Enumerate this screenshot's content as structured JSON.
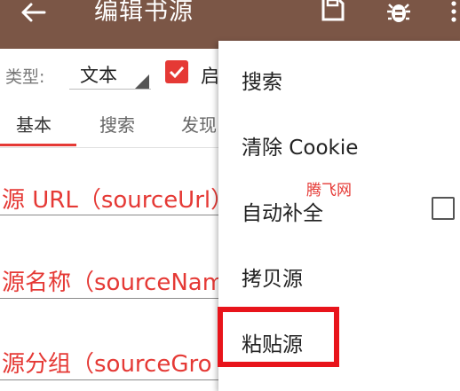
{
  "appbar": {
    "title": "编辑书源",
    "icons": [
      "back-arrow-icon",
      "save-icon",
      "bug-icon",
      "overflow-icon"
    ]
  },
  "type_row": {
    "label": "类型:",
    "value": "文本",
    "enabled_checked": true,
    "enabled_label": "启"
  },
  "tabs": {
    "items": [
      "基本",
      "搜索",
      "发现"
    ],
    "active": "基本"
  },
  "fields": [
    "源 URL（sourceUrl）",
    "源名称（sourceNam",
    "源分组（sourceGro"
  ],
  "menu": {
    "items": [
      "搜索",
      "清除 Cookie",
      "自动补全",
      "拷贝源",
      "粘贴源"
    ],
    "auto_complete_checked": false,
    "highlighted": "粘贴源"
  },
  "watermark": "腾飞网",
  "colors": {
    "appbar": "#7b5646",
    "accent": "#e53935",
    "highlight_box": "#e8141b"
  }
}
